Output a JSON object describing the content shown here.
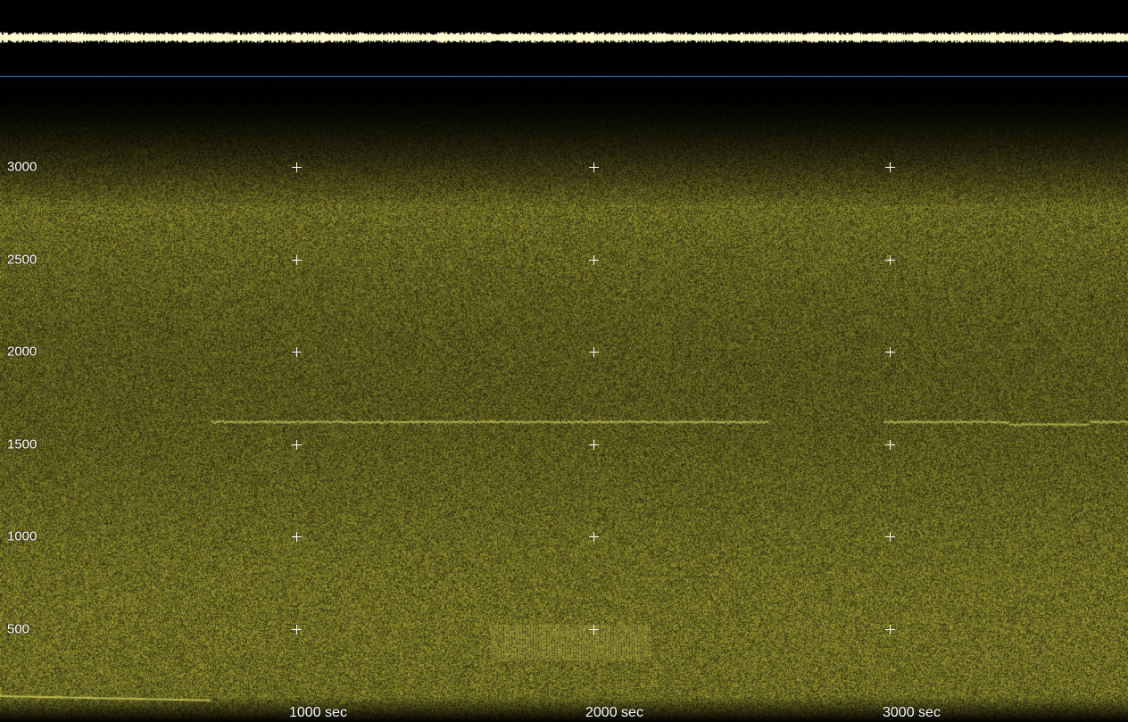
{
  "view": "spectrogram",
  "colors": {
    "waveform": "#fffbd0",
    "spectrum": "#8c8a2c",
    "separator": "#2a7fd4",
    "background": "#000000"
  },
  "frequency_axis": {
    "labels": [
      "3000",
      "2500",
      "2000",
      "1500",
      "1000",
      "500"
    ],
    "values": [
      3000,
      2500,
      2000,
      1500,
      1000,
      500
    ]
  },
  "time_axis": {
    "labels": [
      "1000 sec",
      "2000 sec",
      "3000 sec"
    ],
    "values": [
      1000,
      2000,
      3000
    ]
  }
}
